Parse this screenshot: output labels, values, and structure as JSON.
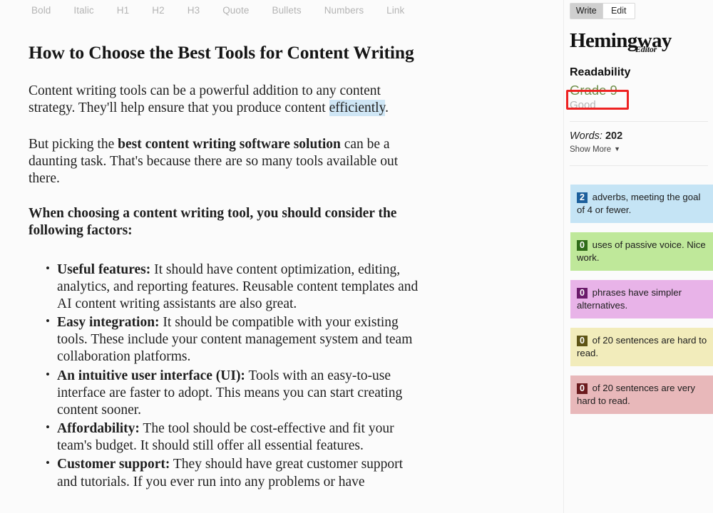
{
  "toolbar": {
    "items": [
      {
        "label": "Bold",
        "name": "bold"
      },
      {
        "label": "Italic",
        "name": "italic"
      },
      {
        "label": "H1",
        "name": "h1"
      },
      {
        "label": "H2",
        "name": "h2"
      },
      {
        "label": "H3",
        "name": "h3"
      },
      {
        "label": "Quote",
        "name": "quote"
      },
      {
        "label": "Bullets",
        "name": "bullets"
      },
      {
        "label": "Numbers",
        "name": "numbers"
      },
      {
        "label": "Link",
        "name": "link"
      }
    ]
  },
  "document": {
    "title": "How to Choose the Best Tools for Content Writing",
    "para1_a": "Content writing tools can be a powerful addition to any content strategy. They'll help ensure that you produce content ",
    "para1_highlight": "efficiently",
    "para1_b": ".",
    "para2_a": "But picking the ",
    "para2_bold": "best content writing software solution",
    "para2_b": " can be a daunting task. That's because there are so many tools available out there.",
    "para3": "When choosing a content writing tool, you should consider the following factors:",
    "bullets": [
      {
        "term": "Useful features:",
        "text": " It should have content optimization, editing, analytics, and reporting features. Reusable content templates and AI content writing assistants are also great."
      },
      {
        "term": "Easy integration:",
        "text": " It should be compatible with your existing tools. These include your content management system and team collaboration platforms."
      },
      {
        "term": "An intuitive user interface (UI):",
        "text": " Tools with an easy-to-use interface are faster to adopt. This means you can start creating content sooner."
      },
      {
        "term": "Affordability:",
        "text": " The tool should be cost-effective and fit your team's budget. It should still offer all essential features."
      },
      {
        "term": "Customer support:",
        "text": " They should have great customer support and tutorials. If you ever run into any problems or have"
      }
    ]
  },
  "sidebar": {
    "mode": {
      "write_label": "Write",
      "edit_label": "Edit",
      "active": "Write"
    },
    "brand": {
      "word": "Hemingway",
      "sub": "Editor"
    },
    "readability": {
      "title": "Readability",
      "grade": "Grade 9",
      "note": "Good",
      "grade_color": "#6f8f4a",
      "annotation_color": "#ee2222"
    },
    "words": {
      "label": "Words:",
      "value": "202"
    },
    "show_more": {
      "label": "Show More",
      "caret": "▼"
    },
    "panels": [
      {
        "name": "adverbs",
        "count": "2",
        "text": " adverbs, meeting the goal of 4 or fewer.",
        "bg": "#c5e4f5",
        "badge_bg": "#1c5f9c"
      },
      {
        "name": "passive-voice",
        "count": "0",
        "text": " uses of passive voice. Nice work.",
        "bg": "#bfe89a",
        "badge_bg": "#2f6b19"
      },
      {
        "name": "simpler-phrases",
        "count": "0",
        "text": " phrases have simpler alternatives.",
        "bg": "#e8b3e8",
        "badge_bg": "#6b1b6b"
      },
      {
        "name": "hard-sentences",
        "count": "0",
        "text": " of 20 sentences are hard to read.",
        "bg": "#f2ecbb",
        "badge_bg": "#5e5415"
      },
      {
        "name": "very-hard-sentences",
        "count": "0",
        "text": " of 20 sentences are very hard to read.",
        "bg": "#e8b8ba",
        "badge_bg": "#6b1a1d"
      }
    ]
  }
}
